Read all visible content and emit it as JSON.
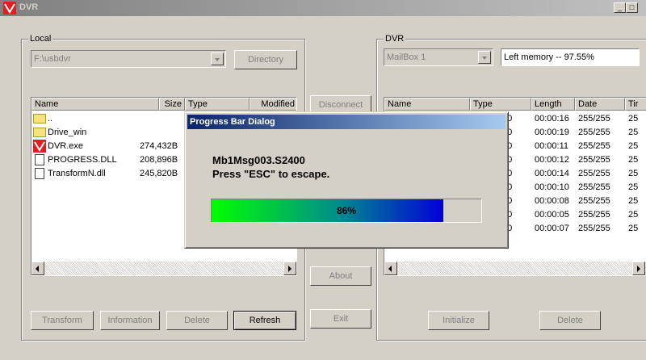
{
  "window": {
    "title": "DVR"
  },
  "local": {
    "group_label": "Local",
    "path": "F:\\usbdvr",
    "directory_btn": "Directory",
    "columns": [
      "Name",
      "Size",
      "Type",
      "Modified"
    ],
    "files": [
      {
        "name": "..",
        "size": "",
        "icon": "folder-icon"
      },
      {
        "name": "Drive_win",
        "size": "",
        "icon": "folder-icon"
      },
      {
        "name": "DVR.exe",
        "size": "274,432B",
        "icon": "dvr-app-icon"
      },
      {
        "name": "PROGRESS.DLL",
        "size": "208,896B",
        "icon": "file-icon"
      },
      {
        "name": "TransformN.dll",
        "size": "245,820B",
        "icon": "file-icon"
      }
    ],
    "buttons": {
      "transform": "Transform",
      "information": "Information",
      "delete": "Delete",
      "refresh": "Refresh"
    }
  },
  "middle": {
    "disconnect": "Disconnect",
    "about": "About",
    "exit": "Exit"
  },
  "dvr": {
    "group_label": "DVR",
    "mailbox": "MailBox 1",
    "memory": "Left memory -- 97.55%",
    "columns": [
      "Name",
      "Type",
      "Length",
      "Date",
      "Tir"
    ],
    "rows": [
      {
        "type": "00",
        "length": "00:00:16",
        "date": "255/255",
        "time": "25"
      },
      {
        "type": "00",
        "length": "00:00:19",
        "date": "255/255",
        "time": "25"
      },
      {
        "type": "00",
        "length": "00:00:11",
        "date": "255/255",
        "time": "25"
      },
      {
        "type": "00",
        "length": "00:00:12",
        "date": "255/255",
        "time": "25"
      },
      {
        "type": "00",
        "length": "00:00:14",
        "date": "255/255",
        "time": "25"
      },
      {
        "type": "00",
        "length": "00:00:10",
        "date": "255/255",
        "time": "25"
      },
      {
        "type": "00",
        "length": "00:00:08",
        "date": "255/255",
        "time": "25"
      },
      {
        "type": "00",
        "length": "00:00:05",
        "date": "255/255",
        "time": "25"
      },
      {
        "type": "00",
        "length": "00:00:07",
        "date": "255/255",
        "time": "25"
      }
    ],
    "buttons": {
      "initialize": "Initialize",
      "delete": "Delete"
    }
  },
  "dialog": {
    "title": "Progress Bar Dialog",
    "line1": "Mb1Msg003.S2400",
    "line2": "Press \"ESC\" to escape.",
    "progress_percent": 86,
    "progress_label": "86%"
  },
  "colors": {
    "progress_start": "#00ff00",
    "progress_end": "#0000d8",
    "dialog_title": "#0a246a"
  }
}
